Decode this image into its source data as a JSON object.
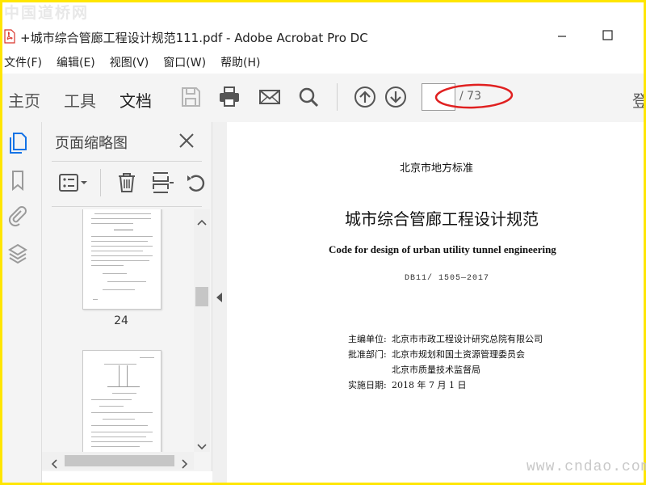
{
  "watermarks": {
    "top": "中国道桥网",
    "bottom": "www.cndao.com"
  },
  "window": {
    "title": "+城市综合管廊工程设计规范111.pdf - Adobe Acrobat Pro DC"
  },
  "menu": [
    "文件(F)",
    "编辑(E)",
    "视图(V)",
    "窗口(W)",
    "帮助(H)"
  ],
  "toolbar": {
    "tabs": [
      "主页",
      "工具",
      "文档"
    ],
    "active_tab": "文档",
    "page_input_value": "",
    "page_total": "/ 73",
    "cut_off_text": "登"
  },
  "thumbnail_panel": {
    "title": "页面缩略图",
    "thumbnails": [
      {
        "label": "24"
      },
      {
        "label": ""
      }
    ]
  },
  "document": {
    "issuer": "北京市地方标准",
    "title_cn": "城市综合管廊工程设计规范",
    "title_en": "Code for design of urban utility tunnel engineering",
    "code": "DB11/ 1505—2017",
    "meta": [
      {
        "label": "主编单位:",
        "value": "北京市市政工程设计研究总院有限公司"
      },
      {
        "label": "批准部门:",
        "value": "北京市规划和国土资源管理委员会"
      },
      {
        "label": "",
        "value": "北京市质量技术监督局"
      },
      {
        "label": "实施日期:",
        "value": "2018 年 7 月 1 日"
      }
    ]
  },
  "colors": {
    "frame_border": "#ffe600",
    "icon_gray": "#555555",
    "active_icon_blue": "#1473e6",
    "annotation_red": "#e02020",
    "pdf_red": "#d9342b"
  },
  "icons": {
    "tools": [
      "save-icon",
      "print-icon",
      "email-icon",
      "search-icon",
      "page-up-icon",
      "page-down-icon"
    ],
    "rail": [
      "page-thumbnails-icon",
      "bookmark-icon",
      "attachment-icon",
      "layers-icon"
    ],
    "panel": [
      "options-menu-icon",
      "delete-icon",
      "insert-page-icon",
      "rotate-icon"
    ]
  }
}
